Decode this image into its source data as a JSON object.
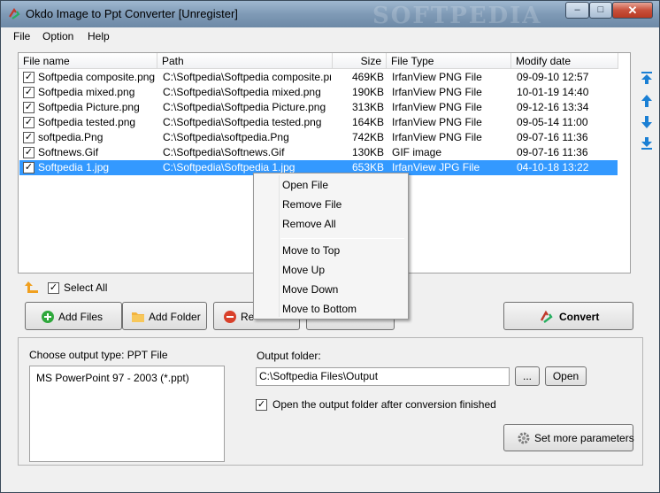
{
  "window": {
    "title": "Okdo Image to Ppt Converter [Unregister]",
    "watermark": "SOFTPEDIA",
    "controls": {
      "minimize": "–",
      "maximize": "□",
      "close": "✕"
    }
  },
  "menu": [
    "File",
    "Option",
    "Help"
  ],
  "table": {
    "columns": [
      "File name",
      "Path",
      "Size",
      "File Type",
      "Modify date"
    ],
    "rows": [
      {
        "checked": true,
        "name": "Softpedia composite.png",
        "path": "C:\\Softpedia\\Softpedia composite.png",
        "size": "469KB",
        "type": "IrfanView PNG File",
        "date": "09-09-10 12:57",
        "selected": false
      },
      {
        "checked": true,
        "name": "Softpedia mixed.png",
        "path": "C:\\Softpedia\\Softpedia mixed.png",
        "size": "190KB",
        "type": "IrfanView PNG File",
        "date": "10-01-19 14:40",
        "selected": false
      },
      {
        "checked": true,
        "name": "Softpedia Picture.png",
        "path": "C:\\Softpedia\\Softpedia Picture.png",
        "size": "313KB",
        "type": "IrfanView PNG File",
        "date": "09-12-16 13:34",
        "selected": false
      },
      {
        "checked": true,
        "name": "Softpedia tested.png",
        "path": "C:\\Softpedia\\Softpedia tested.png",
        "size": "164KB",
        "type": "IrfanView PNG File",
        "date": "09-05-14 11:00",
        "selected": false
      },
      {
        "checked": true,
        "name": "softpedia.Png",
        "path": "C:\\Softpedia\\softpedia.Png",
        "size": "742KB",
        "type": "IrfanView PNG File",
        "date": "09-07-16 11:36",
        "selected": false
      },
      {
        "checked": true,
        "name": "Softnews.Gif",
        "path": "C:\\Softpedia\\Softnews.Gif",
        "size": "130KB",
        "type": "GIF image",
        "date": "09-07-16 11:36",
        "selected": false
      },
      {
        "checked": true,
        "name": "Softpedia 1.jpg",
        "path": "C:\\Softpedia\\Softpedia 1.jpg",
        "size": "653KB",
        "type": "IrfanView JPG File",
        "date": "04-10-18 13:22",
        "selected": true
      }
    ]
  },
  "select_all": {
    "label": "Select All",
    "checked": true
  },
  "buttons": {
    "add_files": "Add Files",
    "add_folder": "Add Folder",
    "remove": "Re",
    "convert": "Convert"
  },
  "context_menu": {
    "items": [
      "Open File",
      "Remove File",
      "Remove All",
      "Move to Top",
      "Move Up",
      "Move Down",
      "Move to Bottom"
    ]
  },
  "output": {
    "type_label": "Choose output type:  PPT File",
    "types": [
      "MS PowerPoint 97 - 2003 (*.ppt)"
    ],
    "folder_label": "Output folder:",
    "folder_value": "C:\\Softpedia Files\\Output",
    "browse": "...",
    "open": "Open",
    "open_after_label": "Open the output folder after conversion finished",
    "open_after_checked": true,
    "more_params": "Set more parameters"
  },
  "colors": {
    "selection": "#3399ff",
    "accent": "#1a7fd4"
  }
}
